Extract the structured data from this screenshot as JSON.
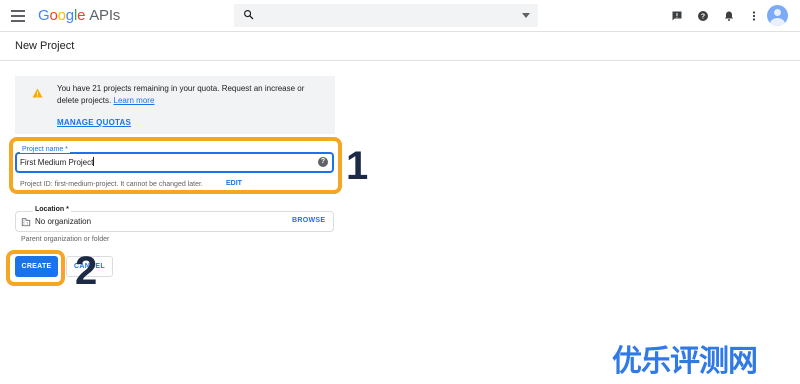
{
  "app": {
    "logo_google": [
      "G",
      "o",
      "o",
      "g",
      "l",
      "e"
    ],
    "logo_suffix": "APIs"
  },
  "search": {
    "placeholder": ""
  },
  "page": {
    "title": "New Project"
  },
  "quota_notice": {
    "text": "You have 21 projects remaining in your quota. Request an increase or delete projects.",
    "learn_more": "Learn more",
    "manage_quotas": "MANAGE QUOTAS"
  },
  "project_name": {
    "label": "Project name *",
    "value": "First Medium Project",
    "help_glyph": "?",
    "project_id_text": "Project ID: first-medium-project. It cannot be changed later.",
    "edit_label": "EDIT"
  },
  "location": {
    "label": "Location *",
    "value": "No organization",
    "browse_label": "BROWSE",
    "hint": "Parent organization or folder"
  },
  "actions": {
    "create_label": "CREATE",
    "cancel_label": "CANCEL"
  },
  "annotations": {
    "step1": "1",
    "step2": "2",
    "color": "#f5a623"
  },
  "watermark": "优乐评测网",
  "colors": {
    "accent": "#1a73e8",
    "warning": "#f9ab00",
    "highlight": "#f5a623"
  },
  "icons": [
    "menu-icon",
    "search-icon",
    "dropdown-caret-icon",
    "feedback-icon",
    "help-icon",
    "notifications-icon",
    "more-vert-icon",
    "avatar",
    "warning-icon",
    "organization-icon"
  ]
}
